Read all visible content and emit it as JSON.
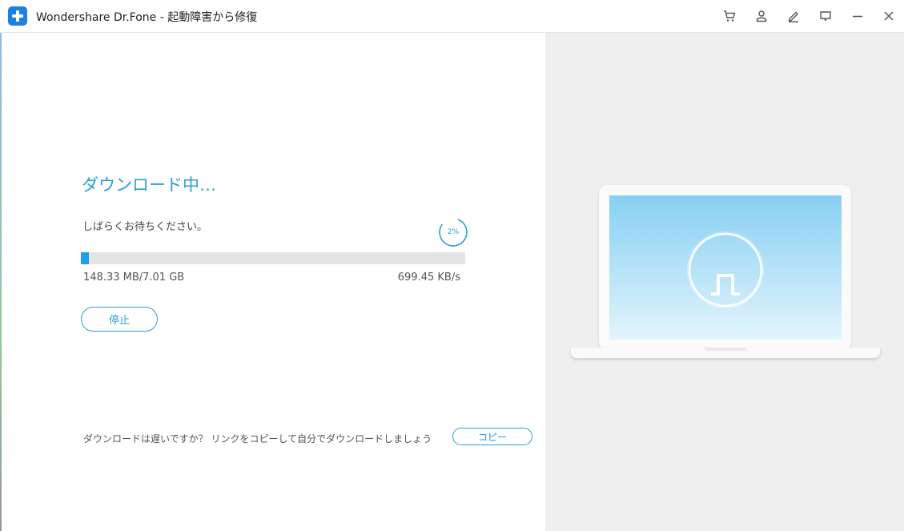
{
  "window": {
    "title": "Wondershare Dr.Fone - 起動障害から修復",
    "logo_icon": "drfone-plus-logo",
    "controls": [
      "cart-icon",
      "account-icon",
      "edit-icon",
      "feedback-icon",
      "minimize-icon",
      "close-icon"
    ]
  },
  "download": {
    "title": "ダウンロード中…",
    "subtitle": "しばらくお待ちください。",
    "percent_label": "2%",
    "progress": 0.021,
    "size_text": "148.33 MB/7.01 GB",
    "speed_text": "699.45 KB/s",
    "stop_label": "停止"
  },
  "footer": {
    "slow_prompt": "ダウンロードは遅いですか？ リンクをコピーして自分でダウンロードしましょう",
    "copy_label": "コピー"
  },
  "illustration": {
    "icon": "laptop-power-icon"
  },
  "colors": {
    "accent": "#2a9fd8",
    "progress_fill": "#1ea0e6",
    "logo": "#1d7fe5"
  }
}
